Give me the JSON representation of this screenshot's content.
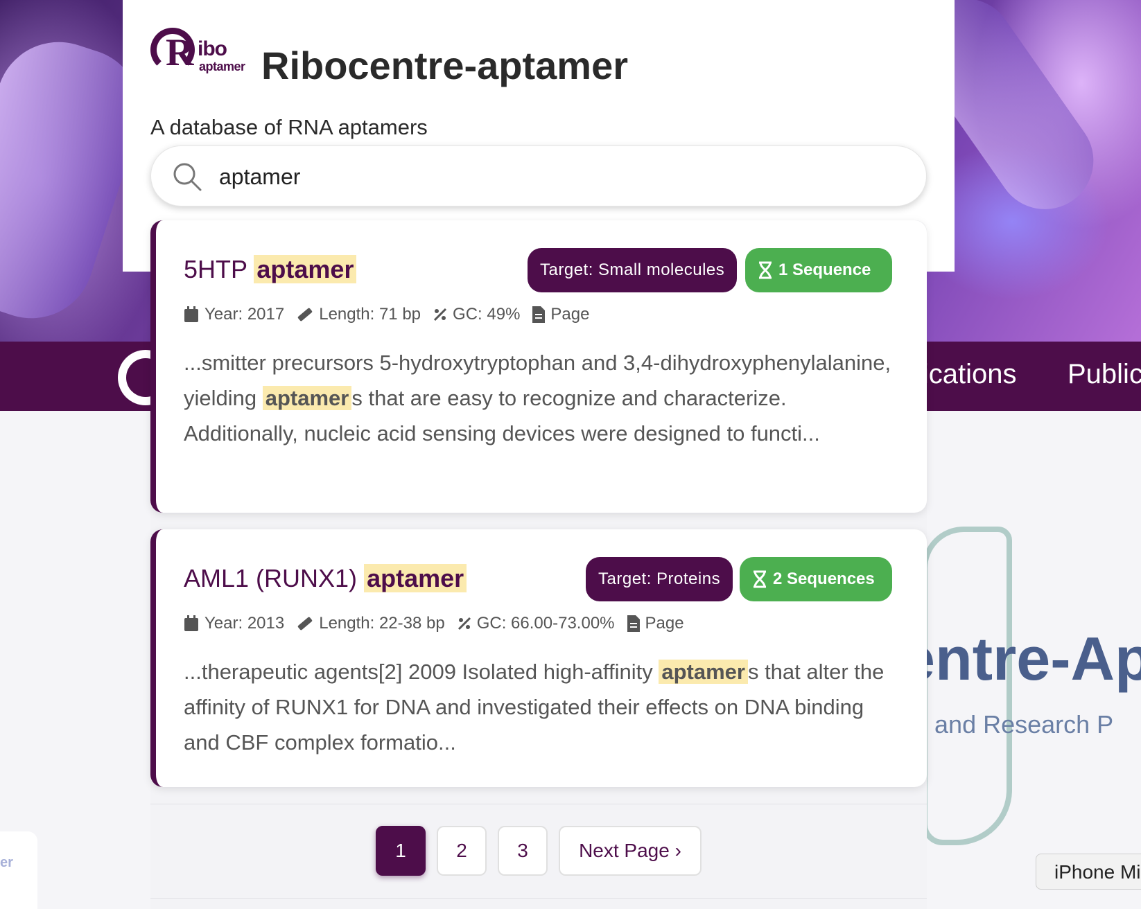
{
  "header": {
    "logo_ribo": "ibo",
    "logo_r": "R",
    "logo_aptamer": "aptamer",
    "title": "Ribocentre-aptamer",
    "subtitle": "A database of RNA aptamers"
  },
  "search": {
    "value": "aptamer",
    "placeholder": ""
  },
  "background": {
    "nav_links": [
      "lications",
      "Public"
    ],
    "hero_title": "entre-Ap",
    "hero_subtitle": "se and Research P",
    "side_card_text": "er",
    "tooltip": "iPhone Mi"
  },
  "results": [
    {
      "title_prefix": "5HTP",
      "title_highlight": "aptamer",
      "target": "Target: Small molecules",
      "sequences": "1 Sequence",
      "year": "Year: 2017",
      "length": "Length: 71 bp",
      "gc": "GC: 49%",
      "page": "Page",
      "snippet_before": "...smitter precursors 5-hydroxytryptophan and 3,4-dihydroxyphenylalanine, yielding ",
      "snippet_highlight": "aptamer",
      "snippet_after": "s that are easy to recognize and characterize. Additionally, nucleic acid sensing devices were designed to functi..."
    },
    {
      "title_prefix": "AML1 (RUNX1)",
      "title_highlight": "aptamer",
      "target": "Target: Proteins",
      "sequences": "2 Sequences",
      "year": "Year: 2013",
      "length": "Length: 22-38 bp",
      "gc": "GC: 66.00-73.00%",
      "page": "Page",
      "snippet_before": "...therapeutic agents[2] 2009 Isolated high-affinity ",
      "snippet_highlight": "aptamer",
      "snippet_after": "s that alter the affinity of RUNX1 for DNA and investigated their effects on DNA binding and CBF complex formatio..."
    }
  ],
  "pagination": {
    "pages": [
      "1",
      "2",
      "3"
    ],
    "active": "1",
    "next": "Next Page ›"
  },
  "colors": {
    "brand": "#4d0d4a",
    "sequence_badge": "#4caf50",
    "highlight": "#fbeaae"
  },
  "icons": {
    "search": "search-icon",
    "year": "calendar-icon",
    "length": "ruler-icon",
    "gc": "percent-icon",
    "page": "file-icon",
    "sequence": "dna-icon"
  }
}
